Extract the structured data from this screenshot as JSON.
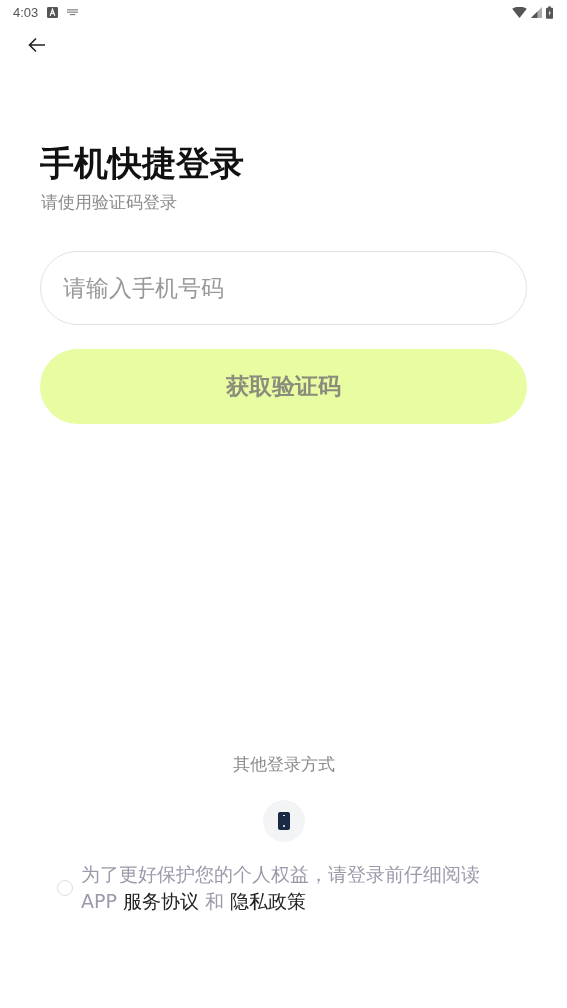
{
  "status_bar": {
    "time": "4:03"
  },
  "title": "手机快捷登录",
  "subtitle": "请使用验证码登录",
  "phone_field": {
    "placeholder": "请输入手机号码"
  },
  "submit_button": {
    "label": "获取验证码",
    "disabled": true
  },
  "other_login": {
    "label": "其他登录方式"
  },
  "agreement": {
    "checked": false,
    "text": "为了更好保护您的个人权益，请登录前仔细阅读 APP",
    "link_1": "服务协议",
    "joiner": "和",
    "link_2": "隐私政策"
  }
}
